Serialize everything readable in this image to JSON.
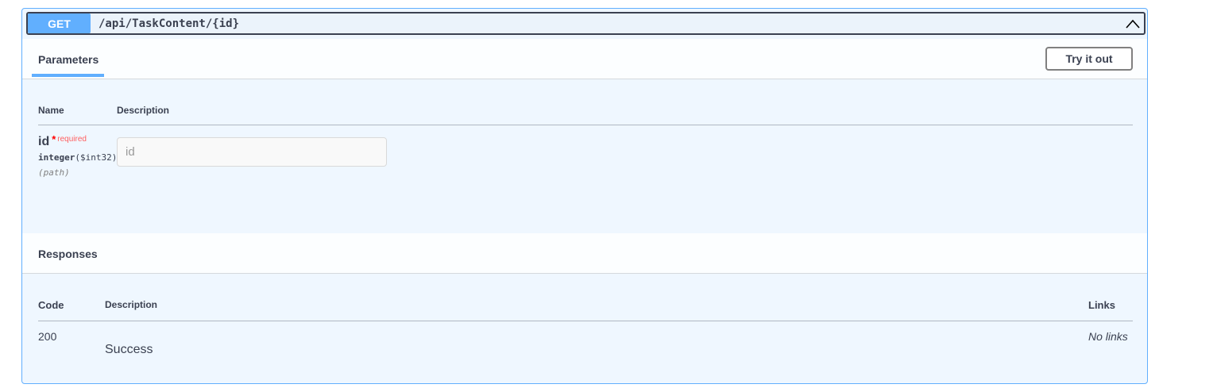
{
  "operation": {
    "method": "GET",
    "path": "/api/TaskContent/{id}",
    "collapse_icon": "chevron-up-icon"
  },
  "parameters": {
    "tab_label": "Parameters",
    "try_button_label": "Try it out",
    "columns": {
      "name": "Name",
      "description": "Description"
    },
    "items": [
      {
        "name": "id",
        "required_mark": "*",
        "required_label": "required",
        "type": "integer",
        "format": "($int32)",
        "in": "(path)",
        "input_placeholder": "id",
        "input_value": ""
      }
    ]
  },
  "responses": {
    "title": "Responses",
    "columns": {
      "code": "Code",
      "description": "Description",
      "links": "Links"
    },
    "rows": [
      {
        "code": "200",
        "description": "Success",
        "links": "No links"
      }
    ]
  },
  "colors": {
    "accent": "#61affe",
    "text": "#3b4151",
    "required": "#ff0000"
  }
}
